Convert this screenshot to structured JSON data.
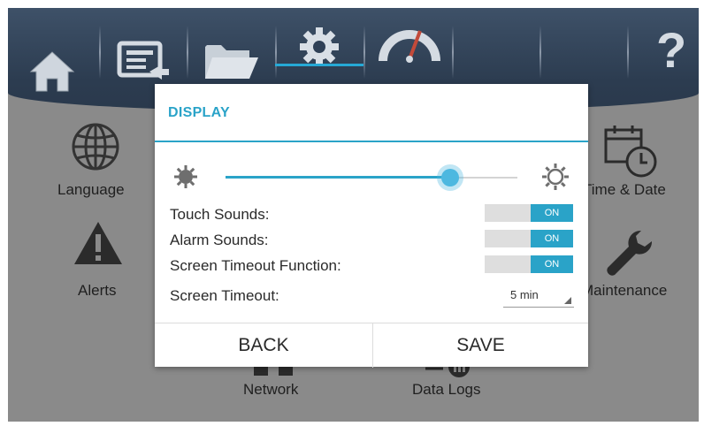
{
  "toolbar": {
    "tabs": [
      {
        "icon": "home-icon"
      },
      {
        "icon": "monitor-arrow-icon"
      },
      {
        "icon": "folder-icon"
      },
      {
        "icon": "gear-icon",
        "active": true
      },
      {
        "icon": "gauge-icon"
      },
      {
        "icon": "help-icon",
        "glyph": "?"
      }
    ]
  },
  "background_menu": {
    "language": "Language",
    "alerts": "Alerts",
    "time_date": "Time & Date",
    "maintenance": "Maintenance",
    "network": "Network",
    "data_logs": "Data Logs"
  },
  "dialog": {
    "title": "DISPLAY",
    "brightness": {
      "level_fraction": 0.77,
      "min_icon": "brightness-low-icon",
      "max_icon": "brightness-high-icon"
    },
    "settings": [
      {
        "label": "Touch Sounds:",
        "state": "ON"
      },
      {
        "label": "Alarm Sounds:",
        "state": "ON"
      },
      {
        "label": "Screen Timeout Function:",
        "state": "ON"
      }
    ],
    "timeout": {
      "label": "Screen Timeout:",
      "value": "5 min"
    },
    "back_label": "BACK",
    "save_label": "SAVE"
  },
  "colors": {
    "accent": "#2aa3c8",
    "toolbar": "#2f4056",
    "background": "#8a8a8a"
  }
}
